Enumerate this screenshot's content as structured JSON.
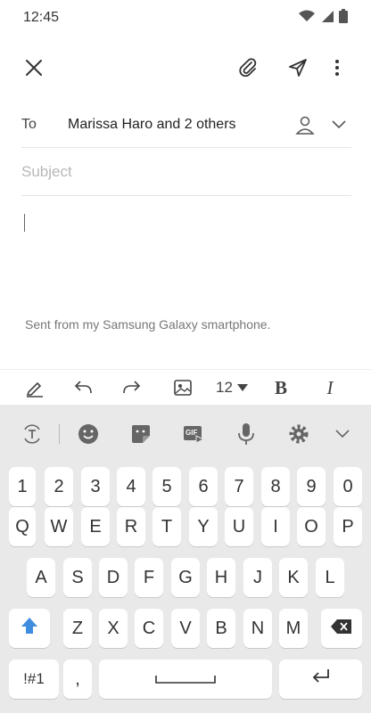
{
  "status_bar": {
    "time": "12:45"
  },
  "compose": {
    "to_label": "To",
    "recipients": "Marissa Haro and 2 others",
    "subject_placeholder": "Subject",
    "subject_value": "",
    "signature": "Sent from my Samsung Galaxy smartphone."
  },
  "format_toolbar": {
    "font_size": "12",
    "bold_label": "B",
    "italic_label": "I"
  },
  "keyboard": {
    "number_row": [
      "1",
      "2",
      "3",
      "4",
      "5",
      "6",
      "7",
      "8",
      "9",
      "0"
    ],
    "row1": [
      "Q",
      "W",
      "E",
      "R",
      "T",
      "Y",
      "U",
      "I",
      "O",
      "P"
    ],
    "row2": [
      "A",
      "S",
      "D",
      "F",
      "G",
      "H",
      "J",
      "K",
      "L"
    ],
    "row3": [
      "Z",
      "X",
      "C",
      "V",
      "B",
      "N",
      "M"
    ],
    "symbols_key": "!#1",
    "comma_key": ",",
    "gif_label": "GIF"
  },
  "colors": {
    "shift_accent": "#3f8de0",
    "keyboard_bg": "#e9e9e9"
  }
}
